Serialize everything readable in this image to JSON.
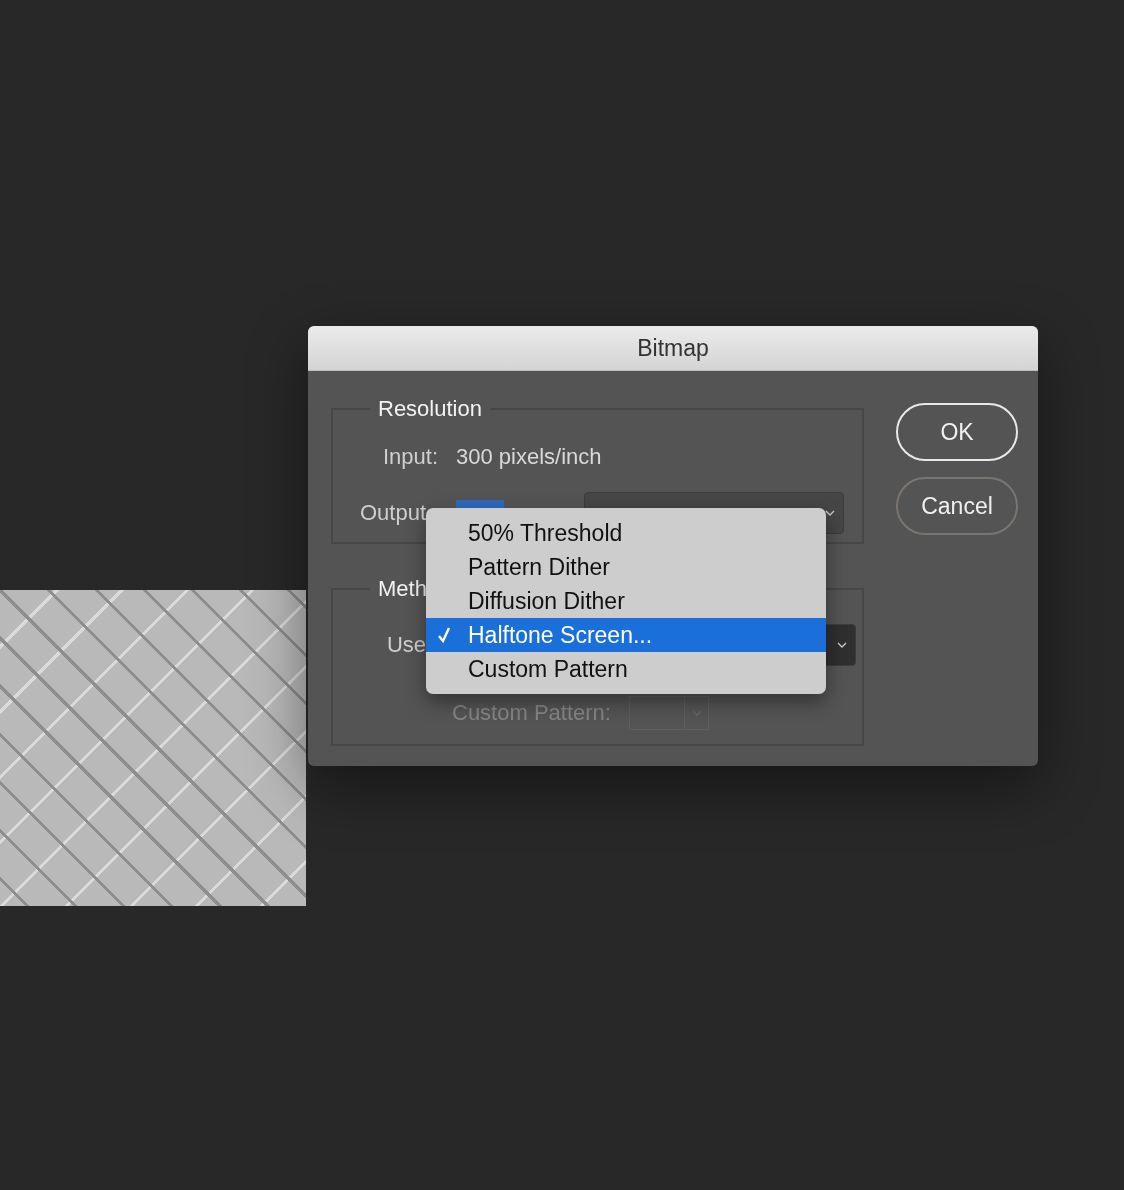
{
  "window": {
    "title": "Bitmap"
  },
  "resolution": {
    "title": "Resolution",
    "input_label": "Input:",
    "input_value": "300 pixels/inch",
    "output_label": "Output"
  },
  "method": {
    "title": "Meth",
    "use_label": "Use",
    "custom_pattern": {
      "label": "Custom Pattern:",
      "disabled": true
    }
  },
  "method_menu": {
    "items": [
      {
        "label": "50% Threshold",
        "selected": false
      },
      {
        "label": "Pattern Dither",
        "selected": false
      },
      {
        "label": "Diffusion Dither",
        "selected": false
      },
      {
        "label": "Halftone Screen...",
        "selected": true
      },
      {
        "label": "Custom Pattern",
        "selected": false
      }
    ]
  },
  "buttons": [
    {
      "label": "OK",
      "default": true
    },
    {
      "label": "Cancel",
      "default": false
    }
  ]
}
